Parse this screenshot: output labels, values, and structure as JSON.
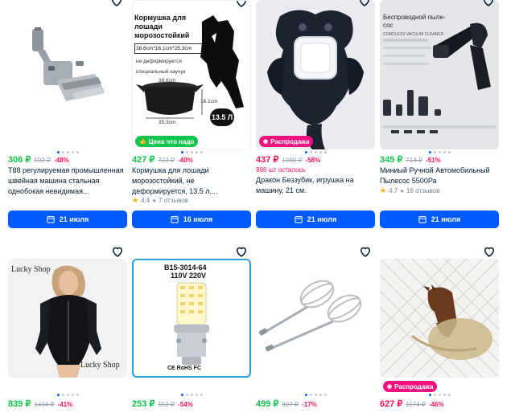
{
  "colors": {
    "accent": "#005bff",
    "price_green": "#10c44c",
    "price_pink": "#f91155",
    "badge_green": "#10c44c",
    "badge_pink": "#f1117e"
  },
  "row1": [
    {
      "price": "306 ₽",
      "old_price": "592 ₽",
      "discount": "-48%",
      "title": "T88 регулируемая промышленная швейная машина стальная однобокая невидимая...",
      "delivery": "21 июля"
    },
    {
      "image_text": {
        "heading": "Кормушка для лошади морозостойкий",
        "dims": "38.6cm*16.1cm*25.3cm",
        "note1": "не деформируется",
        "note2": "специальный каучук",
        "d1": "38.6cm",
        "d2": "16.1cm",
        "d3": "35.3cm",
        "vol": "13.5 Л"
      },
      "badge": "Цена что надо",
      "price": "427 ₽",
      "old_price": "723 ₽",
      "discount": "-40%",
      "title": "Кормушка для лошади морозостойкий, не деформируется, 13.5 л,...",
      "rating": "4.4",
      "reviews": "7 отзывов",
      "delivery": "16 июля"
    },
    {
      "badge": "Распродажа",
      "price": "437 ₽",
      "old_price": "1060 ₽",
      "discount": "-58%",
      "stock": "998 шт осталось",
      "title": "Дракон Беззубик, игрушка на машину, 21 см.",
      "delivery": "21 июля"
    },
    {
      "image_text": {
        "heading": "Беспроводной пыле-сос",
        "sub": "CORDLESS VACUUM CLEANER"
      },
      "price": "345 ₽",
      "old_price": "714 ₽",
      "discount": "-51%",
      "title": "Миниый Ручной Автомобильный Пылесос 5500Ра",
      "rating": "4.7",
      "reviews": "16 отзывов",
      "delivery": "21 июля"
    }
  ],
  "row2": [
    {
      "image_text": {
        "logo_top": "Lucky Shop",
        "logo_bottom": "Lucky Shop"
      },
      "price": "839 ₽",
      "old_price": "1434 ₽",
      "discount": "-41%"
    },
    {
      "image_text": {
        "model": "B15-3014-64",
        "voltage": "110V 220V"
      },
      "price": "253 ₽",
      "old_price": "552 ₽",
      "discount": "-54%"
    },
    {
      "price": "499 ₽",
      "old_price": "607 ₽",
      "discount": "-17%"
    },
    {
      "badge": "Распродажа",
      "price": "627 ₽",
      "old_price": "1174 ₽",
      "discount": "-46%"
    }
  ]
}
